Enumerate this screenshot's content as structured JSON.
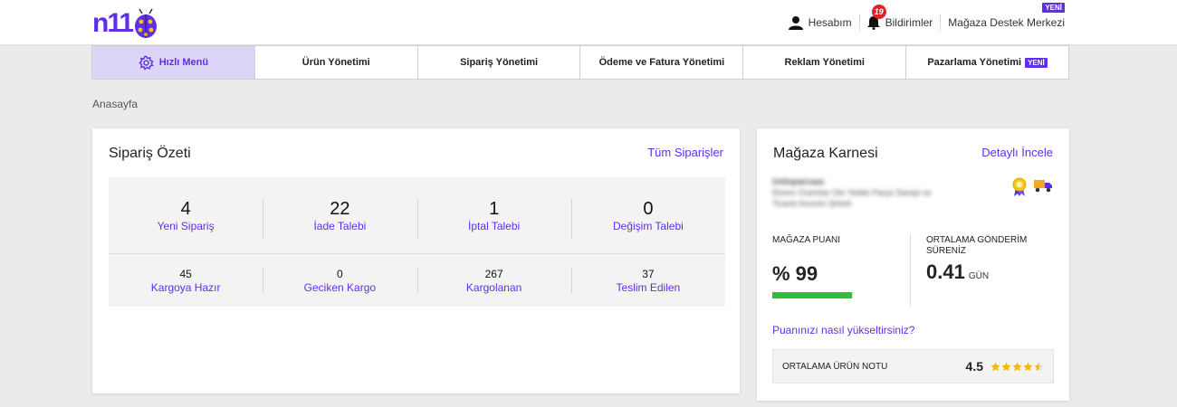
{
  "brand": {
    "logo_text": "n11",
    "accent": "#5f2eea"
  },
  "header": {
    "account_label": "Hesabım",
    "notifications_label": "Bildirimler",
    "notifications_count": "19",
    "support_label": "Mağaza Destek Merkezi",
    "support_badge": "YENİ"
  },
  "nav": {
    "items": [
      {
        "label": "Hızlı Menü",
        "icon": "gear-icon",
        "active": true
      },
      {
        "label": "Ürün Yönetimi"
      },
      {
        "label": "Sipariş Yönetimi"
      },
      {
        "label": "Ödeme ve Fatura Yönetimi"
      },
      {
        "label": "Reklam Yönetimi"
      },
      {
        "label": "Pazarlama Yönetimi",
        "badge": "YENİ"
      }
    ]
  },
  "breadcrumb": "Anasayfa",
  "order_summary": {
    "title": "Sipariş Özeti",
    "link": "Tüm Siparişler",
    "primary": [
      {
        "value": "4",
        "label": "Yeni Sipariş"
      },
      {
        "value": "22",
        "label": "İade Talebi"
      },
      {
        "value": "1",
        "label": "İptal Talebi"
      },
      {
        "value": "0",
        "label": "Değişim Talebi"
      }
    ],
    "secondary": [
      {
        "value": "45",
        "label": "Kargoya Hazır"
      },
      {
        "value": "0",
        "label": "Geciken Kargo"
      },
      {
        "value": "267",
        "label": "Kargolanan"
      },
      {
        "value": "37",
        "label": "Teslim Edilen"
      }
    ]
  },
  "store_card": {
    "title": "Mağaza Karnesi",
    "link": "Detaylı İncele",
    "blurred_line1": "Unluparcası",
    "blurred_line2": "Ekrem Orantılar Oto Yedek Parça Sanayi ve Ticaret Anonim Şirketi",
    "score_caption": "MAĞAZA PUANI",
    "score_value": "% 99",
    "score_percent": 99,
    "shipping_caption": "ORTALAMA GÖNDERİM SÜRENİZ",
    "shipping_value": "0.41",
    "shipping_unit": "GÜN",
    "improve_link": "Puanınızı nasıl yükseltirsiniz?",
    "rating_caption": "ORTALAMA ÜRÜN NOTU",
    "rating_value": "4.5",
    "rating_stars": 4.5,
    "progress_color": "#2fbf3a",
    "star_color": "#f5b800"
  }
}
